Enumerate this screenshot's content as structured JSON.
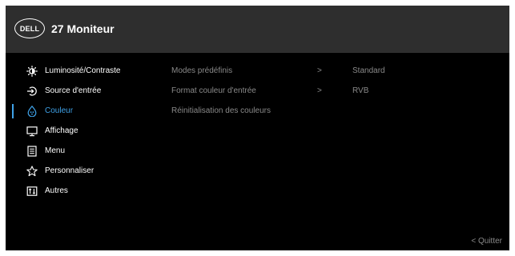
{
  "header": {
    "logo": "DELL",
    "title": "27 Moniteur"
  },
  "menu": {
    "items": [
      {
        "label": "Luminosité/Contraste",
        "icon": "brightness-icon"
      },
      {
        "label": "Source d'entrée",
        "icon": "input-source-icon"
      },
      {
        "label": "Couleur",
        "icon": "color-palette-icon",
        "active": true
      },
      {
        "label": "Affichage",
        "icon": "display-icon"
      },
      {
        "label": "Menu",
        "icon": "menu-list-icon"
      },
      {
        "label": "Personnaliser",
        "icon": "star-icon"
      },
      {
        "label": "Autres",
        "icon": "others-icon"
      }
    ]
  },
  "submenu": {
    "rows": [
      {
        "label": "Modes prédéfinis",
        "arrow": ">",
        "value": "Standard"
      },
      {
        "label": "Format couleur d'entrée",
        "arrow": ">",
        "value": "RVB"
      },
      {
        "label": "Réinitialisation des couleurs"
      }
    ]
  },
  "footer": {
    "exit_label": "< Quitter"
  },
  "colors": {
    "accent": "#3fa2e8",
    "header_bg": "#2e2e2e",
    "osd_bg": "#000000",
    "dim_text": "#8a8a8a"
  }
}
